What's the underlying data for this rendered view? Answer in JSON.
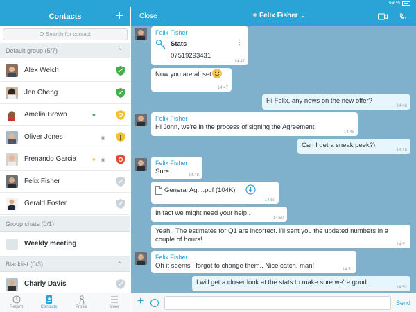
{
  "status": {
    "battery": "69 %"
  },
  "contacts": {
    "title": "Contacts",
    "search_placeholder": "Search for contact",
    "default_group": "Default group (5/7)",
    "people": [
      {
        "name": "Alex Welch",
        "shield": "green"
      },
      {
        "name": "Jen Cheng",
        "shield": "green"
      },
      {
        "name": "Amelia Brown",
        "shield": "yellow"
      },
      {
        "name": "Oliver Jones",
        "shield": "yellow-alert"
      },
      {
        "name": "Frenando Garcia",
        "shield": "red"
      },
      {
        "name": "Felix Fisher",
        "shield": "gray"
      },
      {
        "name": "Gerald Foster",
        "shield": "gray"
      }
    ],
    "group_chats": "Group chats (0/1)",
    "group_item": "Weekly meeting",
    "blacklist": "Blacklist (0/3)",
    "blacklist_item": "Charly Davis"
  },
  "tabs": [
    "Recent",
    "Contacts",
    "Profile",
    "More"
  ],
  "chat": {
    "close_label": "Close",
    "peer_name": "Felix Fisher",
    "messages": [
      {
        "sender": "Felix Fisher",
        "card_title": "Stats",
        "card_number": "07519293431",
        "time": "14:47"
      },
      {
        "text": "Now you are all set",
        "time": "14:47"
      },
      {
        "text": "Hi Felix, any news on the new offer?",
        "time": "14:48"
      },
      {
        "sender": "Felix Fisher",
        "text": "Hi John, we're in the process of signing the Agreement!",
        "time": "14:48"
      },
      {
        "text": "Can I get a sneak peek?)",
        "time": "14:48"
      },
      {
        "sender": "Felix Fisher",
        "text": "Sure",
        "time": "14:48"
      },
      {
        "file": "General Ag....pdf (104K)",
        "time": "14:50"
      },
      {
        "text": "In fact we might need your help..",
        "time": "14:50"
      },
      {
        "text": "Yeah.. The estimates for Q1 are incorrect. I'll sent you the updated numbers in a couple of hours!",
        "time": "14:51"
      },
      {
        "sender": "Felix Fisher",
        "text": "Oh it seems i forgot to change them.. Nice catch, man!",
        "time": "14:51"
      },
      {
        "text": "I will get a closer look at the stats to make sure we're good.",
        "time": "14:52"
      }
    ],
    "send_label": "Send"
  },
  "colors": {
    "accent": "#2aa4d6",
    "chat_bg": "#7fb0cc",
    "outgoing": "#e7f6fd"
  }
}
